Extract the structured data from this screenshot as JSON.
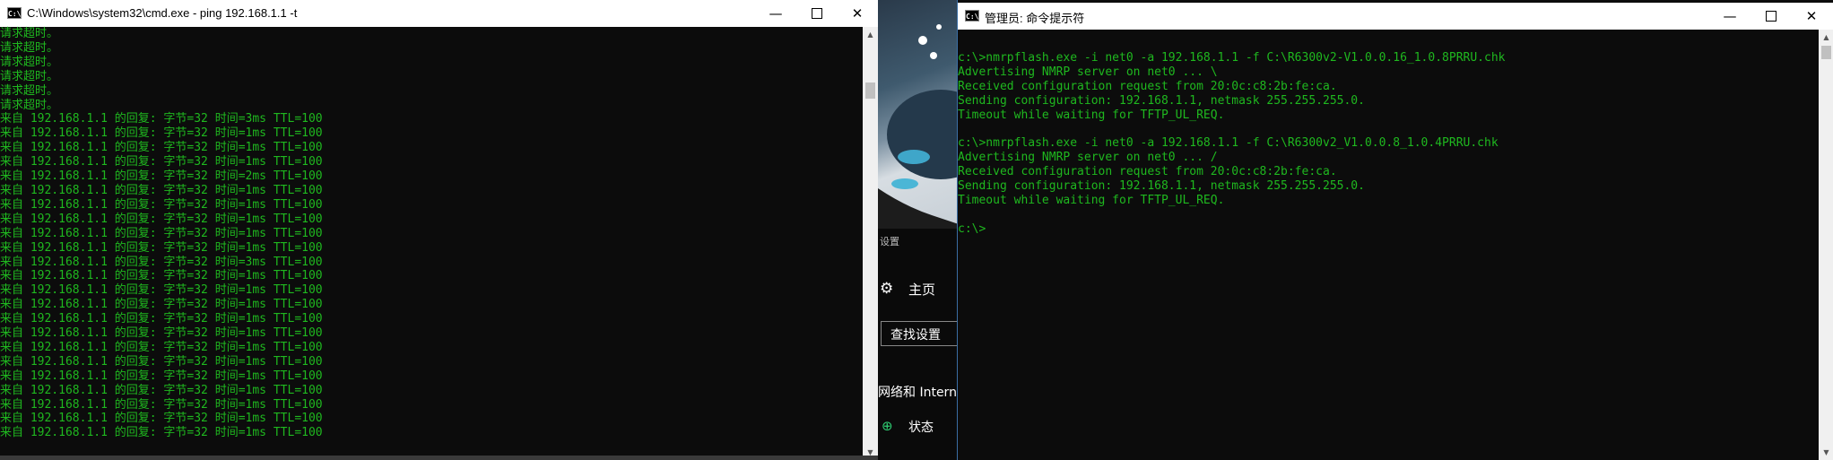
{
  "left_window": {
    "title": "C:\\Windows\\system32\\cmd.exe - ping  192.168.1.1 -t",
    "icon": "C:\\",
    "minimize_glyph": "—",
    "close_glyph": "✕",
    "lines": [
      "请求超时。",
      "请求超时。",
      "请求超时。",
      "请求超时。",
      "请求超时。",
      "请求超时。",
      "来自 192.168.1.1 的回复: 字节=32 时间=3ms TTL=100",
      "来自 192.168.1.1 的回复: 字节=32 时间=1ms TTL=100",
      "来自 192.168.1.1 的回复: 字节=32 时间=1ms TTL=100",
      "来自 192.168.1.1 的回复: 字节=32 时间=1ms TTL=100",
      "来自 192.168.1.1 的回复: 字节=32 时间=2ms TTL=100",
      "来自 192.168.1.1 的回复: 字节=32 时间=1ms TTL=100",
      "来自 192.168.1.1 的回复: 字节=32 时间=1ms TTL=100",
      "来自 192.168.1.1 的回复: 字节=32 时间=1ms TTL=100",
      "来自 192.168.1.1 的回复: 字节=32 时间=1ms TTL=100",
      "来自 192.168.1.1 的回复: 字节=32 时间=1ms TTL=100",
      "来自 192.168.1.1 的回复: 字节=32 时间=3ms TTL=100",
      "来自 192.168.1.1 的回复: 字节=32 时间=1ms TTL=100",
      "来自 192.168.1.1 的回复: 字节=32 时间=1ms TTL=100",
      "来自 192.168.1.1 的回复: 字节=32 时间=1ms TTL=100",
      "来自 192.168.1.1 的回复: 字节=32 时间=1ms TTL=100",
      "来自 192.168.1.1 的回复: 字节=32 时间=1ms TTL=100",
      "来自 192.168.1.1 的回复: 字节=32 时间=1ms TTL=100",
      "来自 192.168.1.1 的回复: 字节=32 时间=1ms TTL=100",
      "来自 192.168.1.1 的回复: 字节=32 时间=1ms TTL=100",
      "来自 192.168.1.1 的回复: 字节=32 时间=1ms TTL=100",
      "来自 192.168.1.1 的回复: 字节=32 时间=1ms TTL=100",
      "来自 192.168.1.1 的回复: 字节=32 时间=1ms TTL=100",
      "来自 192.168.1.1 的回复: 字节=32 时间=1ms TTL=100"
    ]
  },
  "middle_settings": {
    "header": "设置",
    "home_label": "主页",
    "search_placeholder": "查找设置",
    "network_label": "网络和 Intern",
    "status_label": "状态"
  },
  "right_window": {
    "title": "管理员: 命令提示符",
    "icon": "C:\\",
    "minimize_glyph": "—",
    "close_glyph": "✕",
    "lines": [
      "",
      "c:\\>nmrpflash.exe -i net0 -a 192.168.1.1 -f C:\\R6300v2-V1.0.0.16_1.0.8PRRU.chk",
      "Advertising NMRP server on net0 ... \\",
      "Received configuration request from 20:0c:c8:2b:fe:ca.",
      "Sending configuration: 192.168.1.1, netmask 255.255.255.0.",
      "Timeout while waiting for TFTP_UL_REQ.",
      "",
      "c:\\>nmrpflash.exe -i net0 -a 192.168.1.1 -f C:\\R6300v2_V1.0.0.8_1.0.4PRRU.chk",
      "Advertising NMRP server on net0 ... /",
      "Received configuration request from 20:0c:c8:2b:fe:ca.",
      "Sending configuration: 192.168.1.1, netmask 255.255.255.0.",
      "Timeout while waiting for TFTP_UL_REQ.",
      "",
      "c:\\>"
    ]
  },
  "colors": {
    "console_text": "#1fb81f",
    "console_bg": "#0c0c0c",
    "titlebar_bg": "#ffffff"
  }
}
